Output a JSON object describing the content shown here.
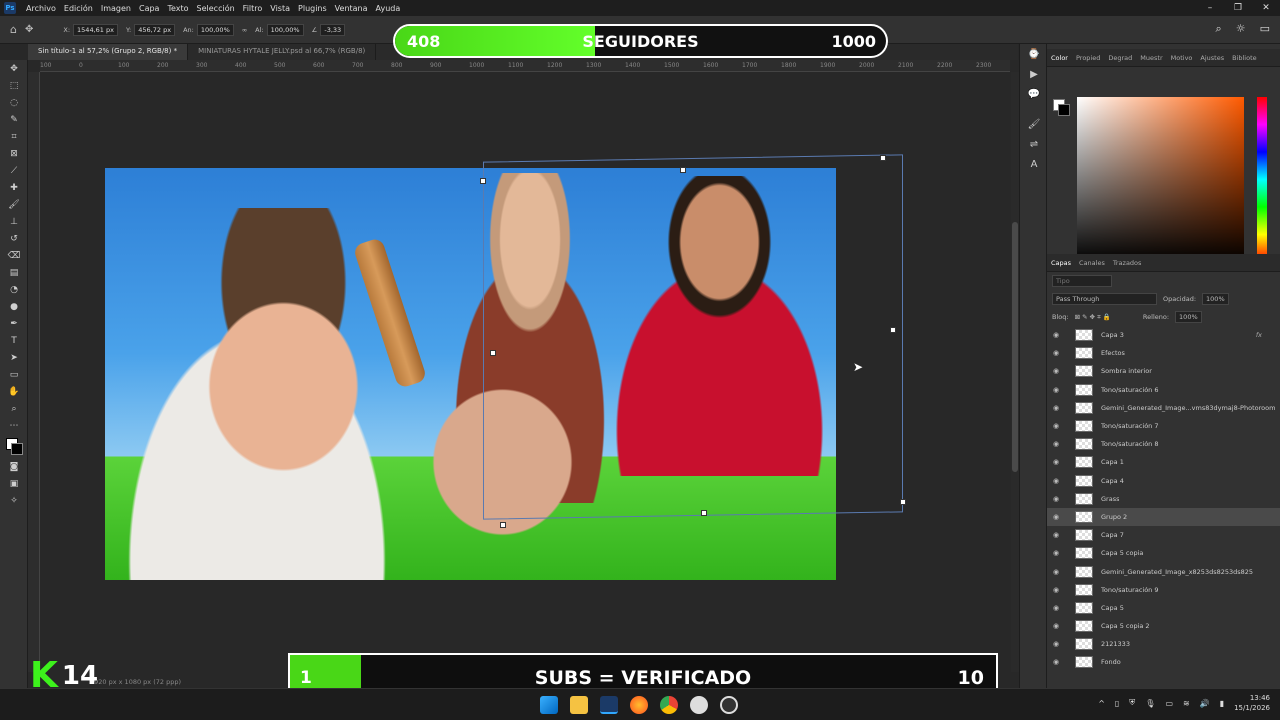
{
  "menubar": {
    "app_icon": "Ps",
    "items": [
      "Archivo",
      "Edición",
      "Imagen",
      "Capa",
      "Texto",
      "Selección",
      "Filtro",
      "Vista",
      "Plugins",
      "Ventana",
      "Ayuda"
    ]
  },
  "optionsbar": {
    "x_label": "X:",
    "x_value": "1544,61 px",
    "y_label": "Y:",
    "y_value": "456,72 px",
    "w_label": "An:",
    "w_value": "100,00%",
    "h_label": "Al:",
    "h_value": "100,00%",
    "angle_value": "-3,33"
  },
  "tabs": [
    {
      "label": "Sin título-1 al 57,2% (Grupo 2, RGB/8) *",
      "active": true
    },
    {
      "label": "MINIATURAS HYTALE JELLY.psd al 66,7% (RGB/8)",
      "active": false
    }
  ],
  "ruler": {
    "ticks": [
      "100",
      "0",
      "100",
      "200",
      "300",
      "400",
      "500",
      "600",
      "700",
      "800",
      "900",
      "1000",
      "1100",
      "1200",
      "1300",
      "1400",
      "1500",
      "1600",
      "1700",
      "1800",
      "1900",
      "2000",
      "2100",
      "2200",
      "2300"
    ]
  },
  "status": {
    "doc_size": "1920 px x 1080 px (72 ppp)"
  },
  "color_panel": {
    "tabs": [
      "Color",
      "Propied",
      "Degrad",
      "Muestr",
      "Motivo",
      "Ajustes",
      "Bibliote"
    ]
  },
  "layers_panel": {
    "tabs": [
      "Capas",
      "Canales",
      "Trazados"
    ],
    "search_placeholder": "Tipo",
    "blend_mode": "Pass Through",
    "opacity_label": "Opacidad:",
    "opacity_value": "100%",
    "lock_label": "Bloq:",
    "fill_label": "Relleno:",
    "fill_value": "100%",
    "layers": [
      {
        "name": "Capa 3",
        "fx": "fx",
        "selected": false
      },
      {
        "name": "Efectos",
        "fx": "",
        "selected": false
      },
      {
        "name": "Sombra interior",
        "fx": "",
        "selected": false
      },
      {
        "name": "Tono/saturación 6",
        "fx": "",
        "selected": false
      },
      {
        "name": "Gemini_Generated_Image...vms83dymaj8-Photoroom",
        "fx": "",
        "selected": false
      },
      {
        "name": "Tono/saturación 7",
        "fx": "",
        "selected": false
      },
      {
        "name": "Tono/saturación 8",
        "fx": "",
        "selected": false
      },
      {
        "name": "Capa 1",
        "fx": "",
        "selected": false
      },
      {
        "name": "Capa 4",
        "fx": "",
        "selected": false
      },
      {
        "name": "Grass",
        "fx": "",
        "selected": false
      },
      {
        "name": "Grupo 2",
        "fx": "",
        "selected": true
      },
      {
        "name": "Capa 7",
        "fx": "",
        "selected": false
      },
      {
        "name": "Capa 5 copia",
        "fx": "",
        "selected": false
      },
      {
        "name": "Gemini_Generated_Image_x8253ds8253ds825",
        "fx": "",
        "selected": false
      },
      {
        "name": "Tono/saturación 9",
        "fx": "",
        "selected": false
      },
      {
        "name": "Capa 5",
        "fx": "",
        "selected": false
      },
      {
        "name": "Capa 5 copia 2",
        "fx": "",
        "selected": false
      },
      {
        "name": "2121333",
        "fx": "",
        "selected": false
      },
      {
        "name": "Fondo",
        "fx": "",
        "selected": false
      }
    ]
  },
  "overlay_top": {
    "count": "408",
    "label": "SEGUIDORES",
    "goal": "1000",
    "progress": 0.408
  },
  "overlay_bottom": {
    "count": "1",
    "label": "SUBS = VERIFICADO",
    "goal": "10",
    "progress": 0.1
  },
  "brand": {
    "letter": "K",
    "number": "14"
  },
  "clock": {
    "time": "13:46",
    "date": "15/1/2026"
  },
  "colors": {
    "accent_green": "#49d717",
    "ps_blue": "#31a8ff",
    "panel_bg": "#323232"
  }
}
